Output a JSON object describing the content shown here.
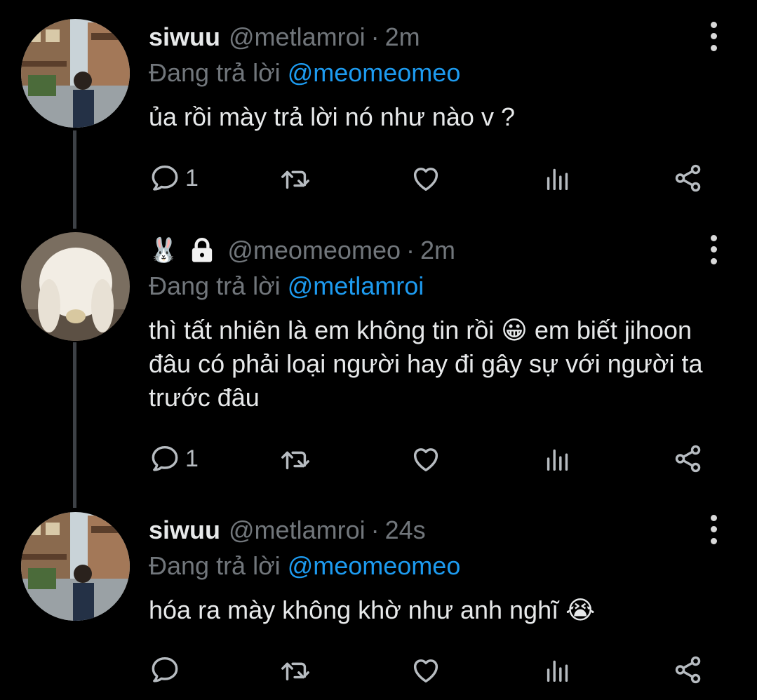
{
  "tweets": [
    {
      "display_name": "siwuu",
      "handle": "@metlamroi",
      "separator": "·",
      "time": "2m",
      "reply_prefix": "Đang trả lời",
      "reply_mention": "@meomeomeo",
      "text": "ủa rồi mày trả lời nó như nào v ?",
      "reply_count": "1",
      "avatar": "photo-man-street-icon"
    },
    {
      "display_name": "🐰",
      "locked": true,
      "handle": "@meomeomeo",
      "separator": "·",
      "time": "2m",
      "reply_prefix": "Đang trả lời",
      "reply_mention": "@metlamroi",
      "text": "thì tất nhiên là em không tin rồi 😀 em biết jihoon đâu có phải loại người hay đi gây sự với người ta trước đâu",
      "reply_count": "1",
      "avatar": "photo-white-bunny-icon"
    },
    {
      "display_name": "siwuu",
      "handle": "@metlamroi",
      "separator": "·",
      "time": "24s",
      "reply_prefix": "Đang trả lời",
      "reply_mention": "@meomeomeo",
      "text": "hóa ra mày không khờ như anh nghĩ 😭",
      "reply_count": "",
      "avatar": "photo-man-street-icon"
    }
  ],
  "icons": [
    "reply-icon",
    "retweet-icon",
    "like-icon",
    "analytics-icon",
    "share-icon",
    "more-options-icon",
    "lock-icon"
  ],
  "colors": {
    "background": "#000000",
    "mention": "#1d9bf0",
    "secondary_text": "#71767b",
    "thread_line": "#3d4146"
  }
}
